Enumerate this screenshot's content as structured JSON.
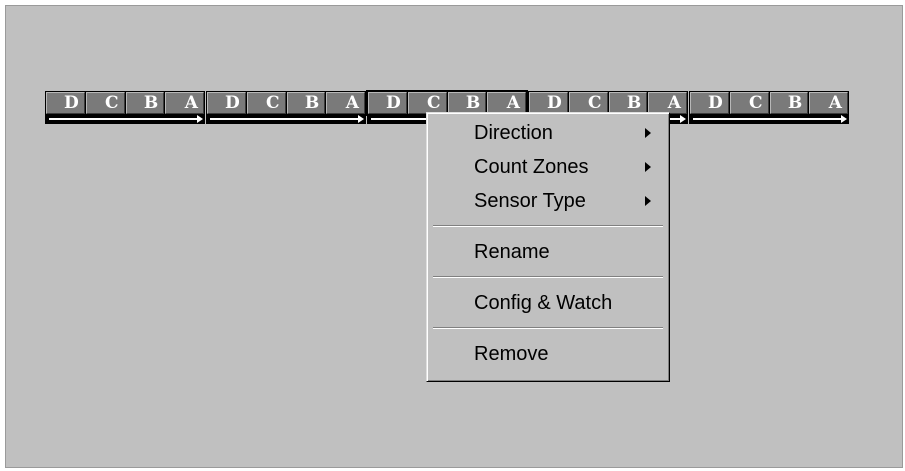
{
  "sensors": [
    {
      "zones": [
        "D",
        "C",
        "B",
        "A"
      ],
      "selected": false
    },
    {
      "zones": [
        "D",
        "C",
        "B",
        "A"
      ],
      "selected": false
    },
    {
      "zones": [
        "D",
        "C",
        "B",
        "A"
      ],
      "selected": true
    },
    {
      "zones": [
        "D",
        "C",
        "B",
        "A"
      ],
      "selected": false
    },
    {
      "zones": [
        "D",
        "C",
        "B",
        "A"
      ],
      "selected": false
    }
  ],
  "context_menu": {
    "items": [
      {
        "label": "Direction",
        "submenu": true
      },
      {
        "label": "Count Zones",
        "submenu": true
      },
      {
        "label": "Sensor Type",
        "submenu": true
      },
      {
        "label": "Rename",
        "submenu": false
      },
      {
        "label": "Config & Watch",
        "submenu": false
      },
      {
        "label": "Remove",
        "submenu": false
      }
    ]
  },
  "colors": {
    "background": "#c0c0c0",
    "zone_fill": "#7a7a7a",
    "zone_text": "#ffffff",
    "track": "#000000"
  }
}
